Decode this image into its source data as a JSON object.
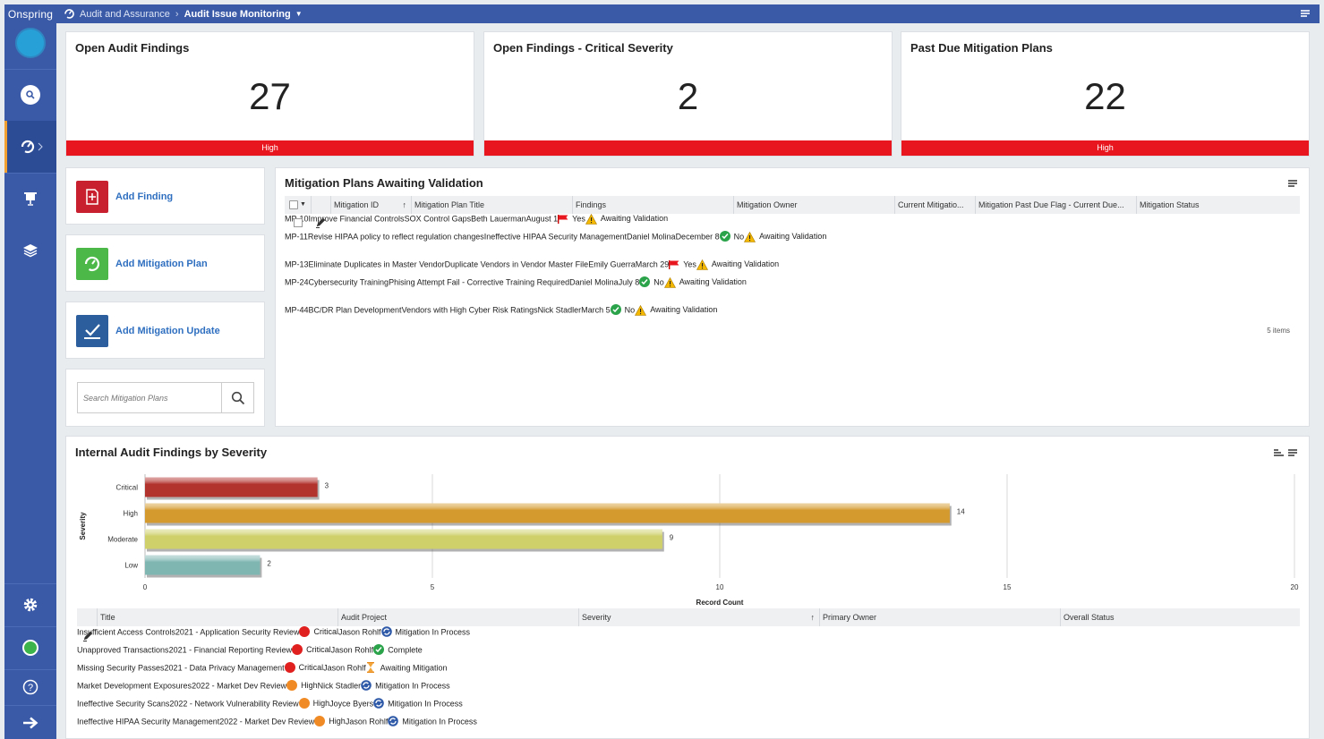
{
  "app": {
    "logo": "Onspring"
  },
  "breadcrumb": {
    "parent": "Audit and Assurance",
    "current": "Audit Issue Monitoring"
  },
  "kpis": [
    {
      "title": "Open Audit Findings",
      "value": "27",
      "band": "High"
    },
    {
      "title": "Open Findings - Critical Severity",
      "value": "2",
      "band": ""
    },
    {
      "title": "Past Due Mitigation Plans",
      "value": "22",
      "band": "High"
    }
  ],
  "actions": {
    "add_finding": "Add Finding",
    "add_mitigation_plan": "Add Mitigation Plan",
    "add_mitigation_update": "Add Mitigation Update",
    "search_placeholder": "Search Mitigation Plans"
  },
  "mitigation_table": {
    "title": "Mitigation Plans Awaiting Validation",
    "columns": [
      "Mitigation ID",
      "Mitigation Plan Title",
      "Findings",
      "Mitigation Owner",
      "Current Mitigatio...",
      "Mitigation Past Due Flag - Current Due...",
      "Mitigation Status"
    ],
    "sort_indicator": "↑",
    "rows": [
      {
        "id": "MP-10",
        "title": "Improve Financial Controls",
        "findings": "SOX Control Gaps",
        "owner": "Beth Lauerman",
        "date": "August 1",
        "past_due": "Yes",
        "status": "Awaiting Validation"
      },
      {
        "id": "MP-11",
        "title": "Revise HIPAA policy to reflect regulation changes",
        "findings": "Ineffective HIPAA Security Management",
        "owner": "Daniel Molina",
        "date": "December 8",
        "past_due": "No",
        "status": "Awaiting Validation"
      },
      {
        "id": "MP-13",
        "title": "Eliminate Duplicates in Master Vendor",
        "findings": "Duplicate Vendors in Vendor Master File",
        "owner": "Emily Guerra",
        "date": "March 29",
        "past_due": "Yes",
        "status": "Awaiting Validation"
      },
      {
        "id": "MP-24",
        "title": "Cybersecurity Training",
        "findings": "Phising Attempt Fail - Corrective Training Required",
        "owner": "Daniel Molina",
        "date": "July 8",
        "past_due": "No",
        "status": "Awaiting Validation"
      },
      {
        "id": "MP-44",
        "title": "BC/DR Plan Development",
        "findings": "Vendors with High Cyber Risk Ratings",
        "owner": "Nick Stadler",
        "date": "March 5",
        "past_due": "No",
        "status": "Awaiting Validation"
      }
    ],
    "item_count": "5 items"
  },
  "severity_panel": {
    "title": "Internal Audit Findings by Severity"
  },
  "chart_data": {
    "type": "bar",
    "orientation": "horizontal",
    "title": "Internal Audit Findings by Severity",
    "categories": [
      "Critical",
      "High",
      "Moderate",
      "Low"
    ],
    "values": [
      3,
      14,
      9,
      2
    ],
    "colors": [
      "#b2322d",
      "#d49a2e",
      "#cfd06a",
      "#7fb6b2"
    ],
    "xlabel": "Record Count",
    "ylabel": "Severity",
    "xlim": [
      0,
      20
    ],
    "xticks": [
      0,
      5,
      10,
      15,
      20
    ],
    "grid": true,
    "legend": "none"
  },
  "findings_table": {
    "columns": [
      "Title",
      "Audit Project",
      "Severity",
      "Primary Owner",
      "Overall Status"
    ],
    "sort_indicator": "↑",
    "rows": [
      {
        "title": "Insufficient Access Controls",
        "project": "2021 - Application Security Review",
        "severity": "Critical",
        "owner": "Jason Rohlf",
        "status": "Mitigation In Process",
        "status_icon": "process"
      },
      {
        "title": "Unapproved Transactions",
        "project": "2021 - Financial Reporting Review",
        "severity": "Critical",
        "owner": "Jason Rohlf",
        "status": "Complete",
        "status_icon": "complete"
      },
      {
        "title": "Missing Security Passes",
        "project": "2021 - Data Privacy Management",
        "severity": "Critical",
        "owner": "Jason Rohlf",
        "status": "Awaiting Mitigation",
        "status_icon": "hourglass"
      },
      {
        "title": "Market Development Exposures",
        "project": "2022 - Market Dev Review",
        "severity": "High",
        "owner": "Nick Stadler",
        "status": "Mitigation In Process",
        "status_icon": "process"
      },
      {
        "title": "Ineffective Security Scans",
        "project": "2022 - Network Vulnerability Review",
        "severity": "High",
        "owner": "Joyce Byers",
        "status": "Mitigation In Process",
        "status_icon": "process"
      },
      {
        "title": "Ineffective HIPAA Security Management",
        "project": "2022 - Market Dev Review",
        "severity": "High",
        "owner": "Jason Rohlf",
        "status": "Mitigation In Process",
        "status_icon": "process"
      }
    ]
  },
  "colors": {
    "accent": "#3a5aa8",
    "alert": "#e8161e",
    "link": "#2f6fc0",
    "critical": "#e0201e",
    "high": "#f08a24",
    "ok": "#2aa34a"
  }
}
